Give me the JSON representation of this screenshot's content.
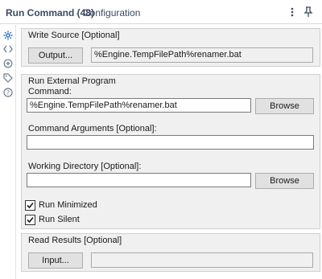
{
  "header": {
    "title": "Run Command (48)",
    "separator": "-",
    "subtitle": "Configuration",
    "more_icon": "vertical-ellipsis-icon",
    "pin_icon": "pin-icon"
  },
  "rail": {
    "items": [
      {
        "icon": "gear-icon",
        "active": true
      },
      {
        "icon": "code-icon",
        "active": false
      },
      {
        "icon": "tool-icon",
        "active": false
      },
      {
        "icon": "tag-icon",
        "active": false
      },
      {
        "icon": "help-icon",
        "active": false
      }
    ]
  },
  "write_source": {
    "title": "Write Source [Optional]",
    "button_label": "Output...",
    "value": "%Engine.TempFilePath%renamer.bat"
  },
  "run_external": {
    "title": "Run External Program",
    "command_label": "Command:",
    "command_value": "%Engine.TempFilePath%renamer.bat",
    "browse_label": "Browse",
    "args_label": "Command Arguments [Optional]:",
    "args_value": "",
    "workdir_label": "Working Directory [Optional]:",
    "workdir_value": "",
    "browse2_label": "Browse",
    "run_minimized_label": "Run Minimized",
    "run_minimized_checked": true,
    "run_silent_label": "Run Silent",
    "run_silent_checked": true
  },
  "read_results": {
    "title": "Read Results [Optional]",
    "button_label": "Input...",
    "value": ""
  },
  "colors": {
    "title": "#3b4a61",
    "accent": "#2b6cc4",
    "panel_bg": "#f0f0f0"
  }
}
